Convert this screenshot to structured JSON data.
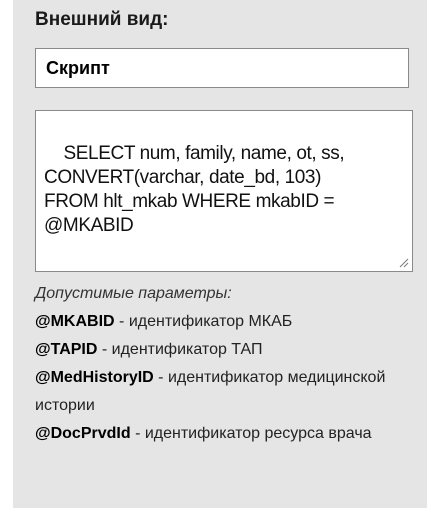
{
  "section": {
    "title": "Внешний вид:"
  },
  "name_field": {
    "value": "Скрипт"
  },
  "script_field": {
    "value": "SELECT num, family, name, ot, ss,\nCONVERT(varchar, date_bd, 103)\nFROM hlt_mkab WHERE mkabID =\n@MKABID"
  },
  "params": {
    "title": "Допустимые параметры:",
    "items": [
      {
        "name": "@MKABID",
        "desc": " - идентификатор МКАБ"
      },
      {
        "name": "@TAPID",
        "desc": " - идентификатор ТАП"
      },
      {
        "name": "@MedHistoryID",
        "desc": " - идентификатор медицинской истории"
      },
      {
        "name": "@DocPrvdId",
        "desc": " - идентификатор ресурса врача"
      }
    ]
  },
  "colors": {
    "panel_bg": "#e5e5e5",
    "border": "#8a8a8a"
  }
}
